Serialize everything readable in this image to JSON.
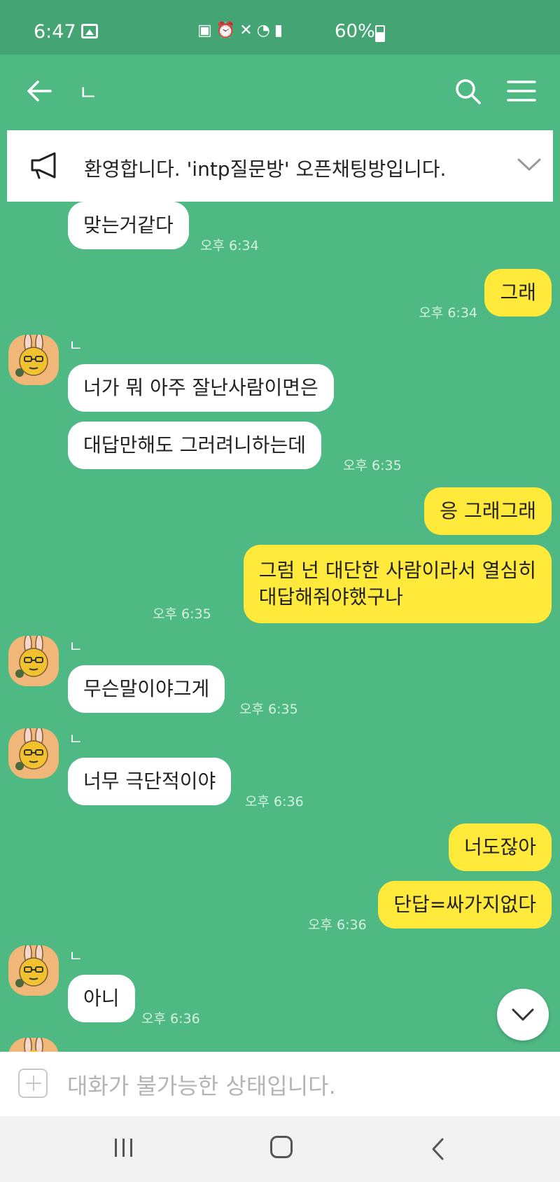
{
  "status_bar": {
    "time": "6:47",
    "battery": "60%"
  },
  "header": {
    "room_title": "ㄴ"
  },
  "notice": {
    "text": "환영합니다. 'intp질문방' 오픈채팅방입니다."
  },
  "chat": {
    "sender_name": "ㄴ",
    "messages": [
      {
        "dir": "in",
        "text": "맞는거같다",
        "time": "오후 6:34"
      },
      {
        "dir": "out",
        "text": "그래",
        "time": "오후 6:34"
      },
      {
        "dir": "in",
        "text": "너가 뭐 아주 잘난사람이면은",
        "time": ""
      },
      {
        "dir": "in",
        "text": "대답만해도 그러려니하는데",
        "time": "오후 6:35"
      },
      {
        "dir": "out",
        "text": "응 그래그래",
        "time": ""
      },
      {
        "dir": "out",
        "text_line1": "그럼 넌 대단한 사람이라서 열심히",
        "text_line2": "대답해줘야했구나",
        "time": "오후 6:35"
      },
      {
        "dir": "in",
        "text": "무슨말이야그게",
        "time": "오후 6:35"
      },
      {
        "dir": "in",
        "text": "너무 극단적이야",
        "time": "오후 6:36"
      },
      {
        "dir": "out",
        "text": "너도잖아",
        "time": ""
      },
      {
        "dir": "out",
        "text": "단답=싸가지없다",
        "time": "오후 6:36"
      },
      {
        "dir": "in",
        "text": "아니",
        "time": "오후 6:36"
      }
    ]
  },
  "input_bar": {
    "placeholder": "대화가 불가능한 상태입니다."
  },
  "colors": {
    "chat_background": "#4fb983",
    "status_bar": "#45a473",
    "outgoing_bubble": "#ffe93a",
    "incoming_bubble": "#ffffff"
  }
}
